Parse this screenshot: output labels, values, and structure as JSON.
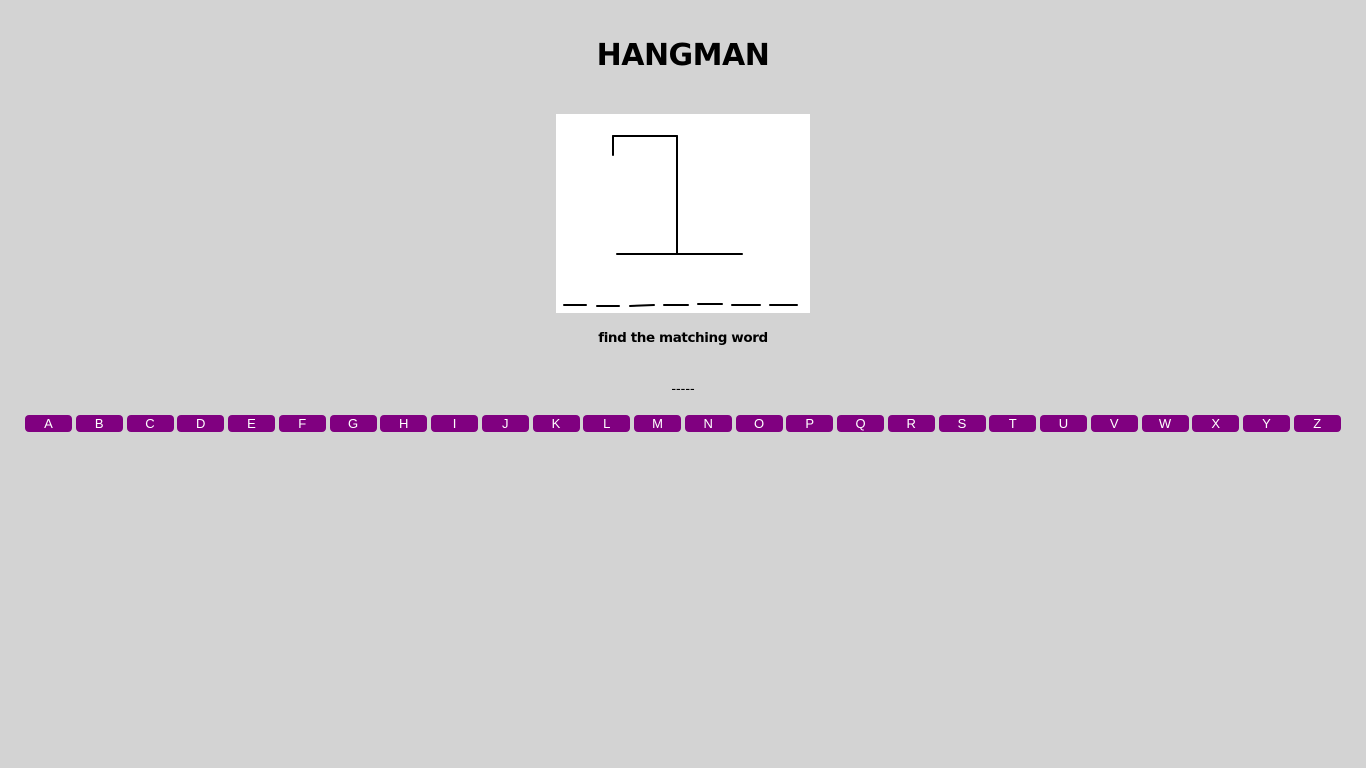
{
  "game": {
    "title": "HANGMAN",
    "hint": "find the matching word",
    "word_display": "-----"
  },
  "keyboard": {
    "letters": [
      "A",
      "B",
      "C",
      "D",
      "E",
      "F",
      "G",
      "H",
      "I",
      "J",
      "K",
      "L",
      "M",
      "N",
      "O",
      "P",
      "Q",
      "R",
      "S",
      "T",
      "U",
      "V",
      "W",
      "X",
      "Y",
      "Z"
    ]
  },
  "colors": {
    "background": "#d3d3d3",
    "button": "#800080",
    "button_text": "#ffffff",
    "canvas": "#ffffff"
  }
}
